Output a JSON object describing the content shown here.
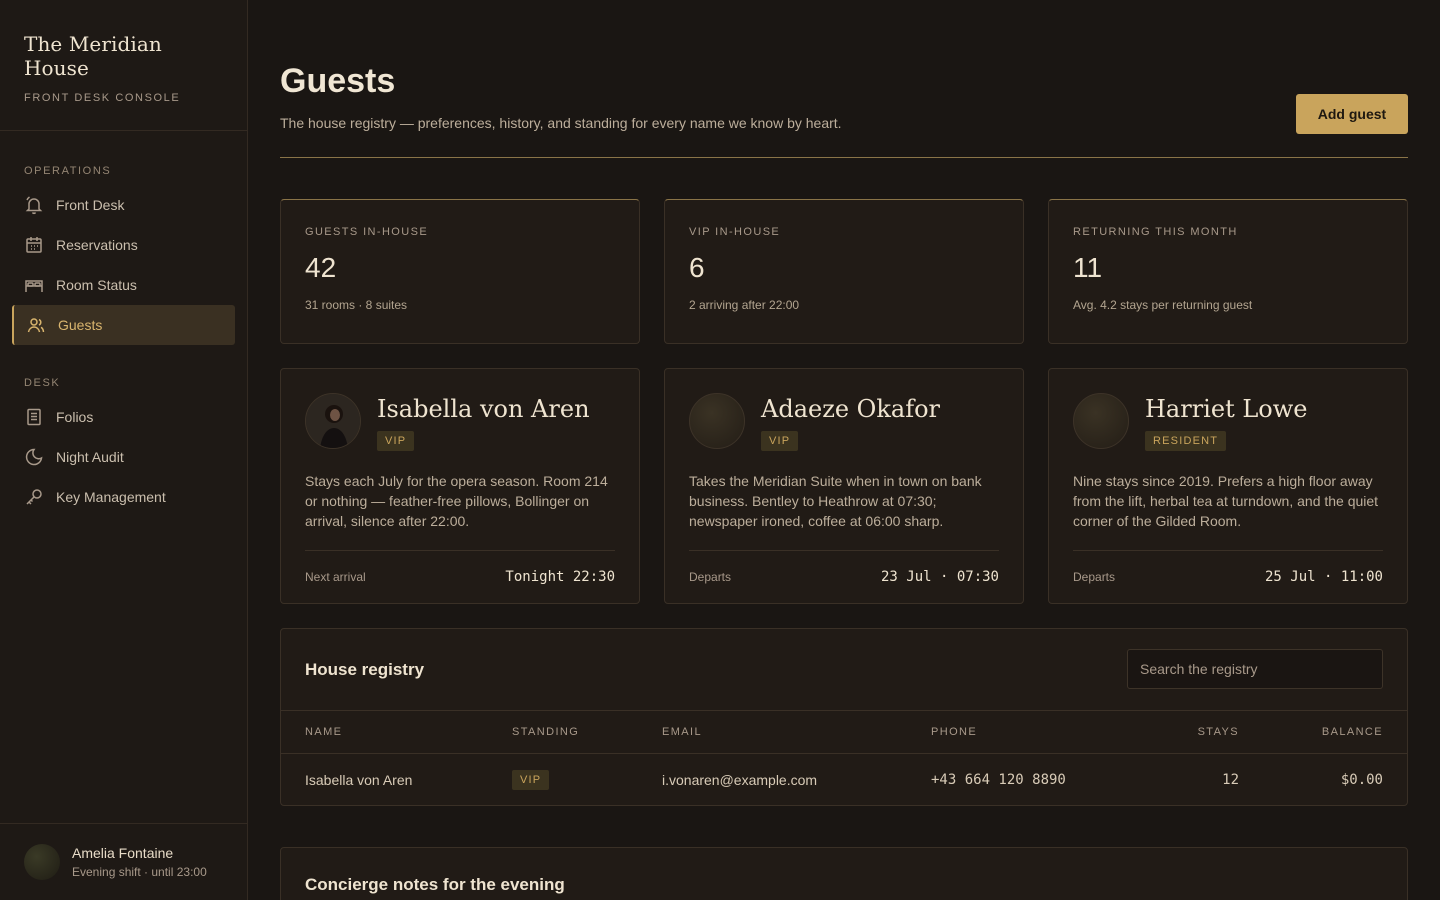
{
  "sidebar": {
    "brand_title": "The Meridian House",
    "brand_subtitle": "FRONT DESK CONSOLE",
    "operations_heading": "OPERATIONS",
    "operations_items": [
      {
        "label": "Front Desk",
        "icon": "bell-icon"
      },
      {
        "label": "Reservations",
        "icon": "calendar-icon"
      },
      {
        "label": "Room Status",
        "icon": "bed-icon"
      },
      {
        "label": "Guests",
        "icon": "users-icon",
        "active": true
      }
    ],
    "desk_heading": "DESK",
    "desk_items": [
      {
        "label": "Folios",
        "icon": "document-icon"
      },
      {
        "label": "Night Audit",
        "icon": "moon-icon"
      },
      {
        "label": "Key Management",
        "icon": "key-icon"
      }
    ],
    "user": {
      "name": "Amelia Fontaine",
      "shift": "Evening shift · until 23:00"
    }
  },
  "header": {
    "title": "Guests",
    "subtitle": "The house registry — preferences, history, and standing for every name we know by heart.",
    "add_button": "Add guest"
  },
  "stats": [
    {
      "label": "GUESTS IN-HOUSE",
      "value": "42",
      "note": "31 rooms · 8 suites"
    },
    {
      "label": "VIP IN-HOUSE",
      "value": "6",
      "note": "2 arriving after 22:00"
    },
    {
      "label": "RETURNING THIS MONTH",
      "value": "11",
      "note": "Avg. 4.2 stays per returning guest"
    }
  ],
  "guest_cards": [
    {
      "name": "Isabella von Aren",
      "badge": "VIP",
      "text": "Stays each July for the opera season. Room 214 or nothing — feather-free pillows, Bollinger on arrival, silence after 22:00.",
      "foot_label": "Next arrival",
      "foot_value": "Tonight 22:30"
    },
    {
      "name": "Adaeze Okafor",
      "badge": "VIP",
      "text": "Takes the Meridian Suite when in town on bank business. Bentley to Heathrow at 07:30; newspaper ironed, coffee at 06:00 sharp.",
      "foot_label": "Departs",
      "foot_value": "23 Jul · 07:30"
    },
    {
      "name": "Harriet Lowe",
      "badge": "RESIDENT",
      "text": "Nine stays since 2019. Prefers a high floor away from the lift, herbal tea at turndown, and the quiet corner of the Gilded Room.",
      "foot_label": "Departs",
      "foot_value": "25 Jul · 11:00"
    }
  ],
  "registry": {
    "title": "House registry",
    "search_placeholder": "Search the registry",
    "columns": {
      "name": "NAME",
      "standing": "STANDING",
      "email": "EMAIL",
      "phone": "PHONE",
      "stays": "STAYS",
      "balance": "BALANCE"
    },
    "rows": [
      {
        "name": "Isabella von Aren",
        "standing": "VIP",
        "email": "i.vonaren@example.com",
        "phone": "+43 664 120 8890",
        "stays": "12",
        "balance": "$0.00"
      }
    ]
  },
  "notes": {
    "title": "Concierge notes for the evening"
  },
  "colors": {
    "accent": "#c9a45c",
    "background": "#1a1613",
    "panel": "#211b16"
  }
}
